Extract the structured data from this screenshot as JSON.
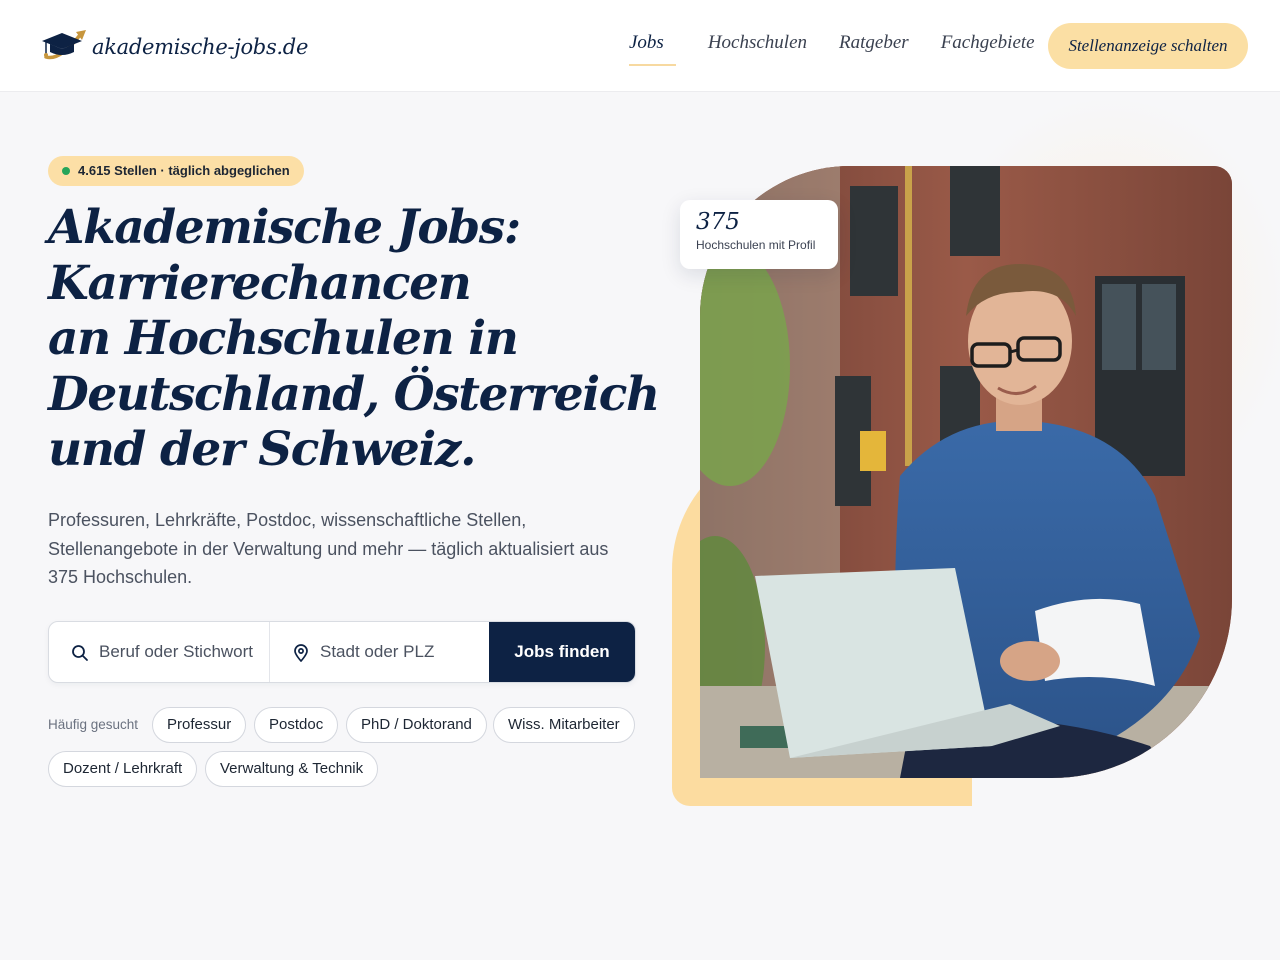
{
  "header": {
    "logo_text": "akademische-jobs.de",
    "nav": [
      {
        "label": "Jobs",
        "active": true
      },
      {
        "label": "Hochschulen",
        "active": false
      },
      {
        "label": "Ratgeber",
        "active": false
      },
      {
        "label": "Fachgebiete",
        "active": false
      }
    ],
    "cta_label": "Stellenanzeige schalten"
  },
  "hero": {
    "badge": "4.615 Stellen · täglich abgeglichen",
    "title_lines": [
      "Akademische Jobs:",
      "Karrierechancen",
      "an Hochschulen in",
      "Deutschland, Österreich",
      "und der Schweiz."
    ],
    "description": "Professuren, Lehrkräfte, Postdoc, wissenschaftliche Stellen, Stellenangebote in der Verwaltung und mehr — täglich aktualisiert aus 375 Hochschulen.",
    "search": {
      "keyword_placeholder": "Beruf oder Stichwort",
      "location_placeholder": "Stadt oder PLZ",
      "button_label": "Jobs finden"
    },
    "popular_label": "Häufig gesucht",
    "chips": [
      "Professur",
      "Postdoc",
      "PhD / Doktorand",
      "Wiss. Mitarbeiter",
      "Dozent / Lehrkraft",
      "Verwaltung & Technik"
    ],
    "stat": {
      "number": "375",
      "label": "Hochschulen mit Profil"
    }
  },
  "colors": {
    "navy": "#0d2244",
    "accent_yellow": "#fcdfa6",
    "badge_dot_green": "#25a55a",
    "background": "#f7f7f9"
  },
  "icons": [
    "graduation-cap-logo-icon",
    "search-icon",
    "location-pin-icon"
  ]
}
